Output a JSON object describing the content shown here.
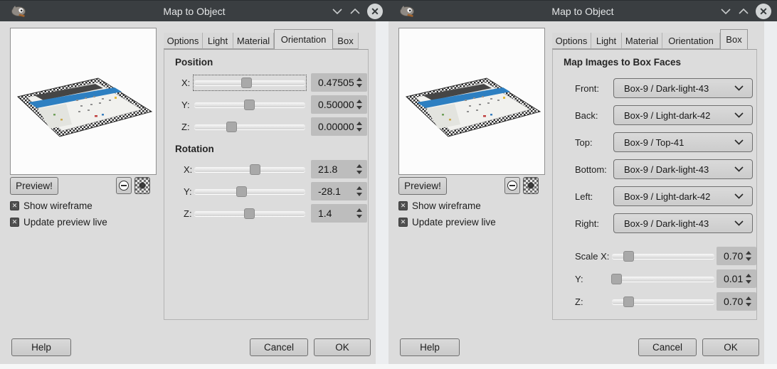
{
  "left": {
    "title": "Map to Object",
    "tabs": [
      "Options",
      "Light",
      "Material",
      "Orientation",
      "Box"
    ],
    "active_tab": "Orientation",
    "preview_button": "Preview!",
    "checkboxes": [
      {
        "label": "Show wireframe",
        "checked": true
      },
      {
        "label": "Update preview live",
        "checked": true
      }
    ],
    "position": {
      "heading": "Position",
      "rows": [
        {
          "label": "X:",
          "value": "0.47505"
        },
        {
          "label": "Y:",
          "value": "0.50000"
        },
        {
          "label": "Z:",
          "value": "0.00000"
        }
      ]
    },
    "rotation": {
      "heading": "Rotation",
      "rows": [
        {
          "label": "X:",
          "value": "21.8"
        },
        {
          "label": "Y:",
          "value": "-28.1"
        },
        {
          "label": "Z:",
          "value": "1.4"
        }
      ]
    },
    "footer": {
      "help": "Help",
      "cancel": "Cancel",
      "ok": "OK"
    }
  },
  "right": {
    "title": "Map to Object",
    "tabs": [
      "Options",
      "Light",
      "Material",
      "Orientation",
      "Box"
    ],
    "active_tab": "Box",
    "preview_button": "Preview!",
    "checkboxes": [
      {
        "label": "Show wireframe",
        "checked": true
      },
      {
        "label": "Update preview live",
        "checked": true
      }
    ],
    "box": {
      "heading": "Map Images to Box Faces",
      "faces": [
        {
          "label": "Front:",
          "value": "Box-9 / Dark-light-43"
        },
        {
          "label": "Back:",
          "value": "Box-9 / Light-dark-42"
        },
        {
          "label": "Top:",
          "value": "Box-9 / Top-41"
        },
        {
          "label": "Bottom:",
          "value": "Box-9 / Dark-light-43"
        },
        {
          "label": "Left:",
          "value": "Box-9 / Light-dark-42"
        },
        {
          "label": "Right:",
          "value": "Box-9 / Dark-light-43"
        }
      ],
      "scale": [
        {
          "label": "Scale X:",
          "value": "0.70"
        },
        {
          "label": "Y:",
          "value": "0.01"
        },
        {
          "label": "Z:",
          "value": "0.70"
        }
      ]
    },
    "footer": {
      "help": "Help",
      "cancel": "Cancel",
      "ok": "OK"
    }
  },
  "colors": {
    "titlebar": "#3a3e41",
    "dialog_bg": "#dcdcdc",
    "accent_blue": "#2d7fc1"
  }
}
